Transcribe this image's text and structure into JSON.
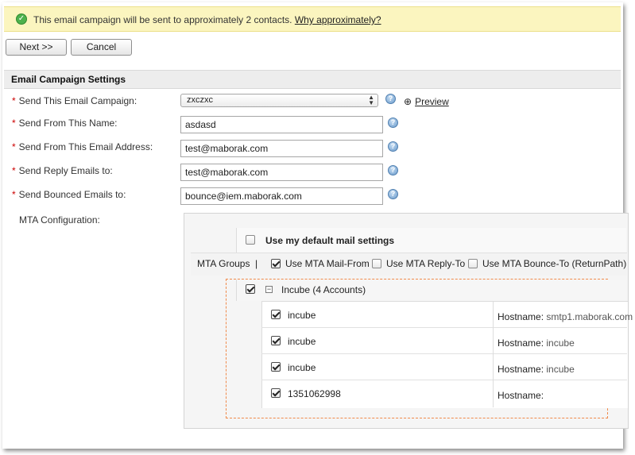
{
  "notice": {
    "message": "This email campaign will be sent to approximately 2 contacts.",
    "link": "Why approximately?"
  },
  "buttons": {
    "next": "Next >>",
    "cancel": "Cancel"
  },
  "section": {
    "title": "Email Campaign Settings"
  },
  "form": {
    "required_mark": "*",
    "campaign": {
      "label": "Send This Email Campaign:",
      "value": "zxczxc",
      "preview": "Preview"
    },
    "from_name": {
      "label": "Send From This Name:",
      "value": "asdasd"
    },
    "from_email": {
      "label": "Send From This Email Address:",
      "value": "test@maborak.com"
    },
    "reply_to": {
      "label": "Send Reply Emails to:",
      "value": "test@maborak.com"
    },
    "bounce_to": {
      "label": "Send Bounced Emails to:",
      "value": "bounce@iem.maborak.com"
    },
    "mta_label": "MTA Configuration:"
  },
  "mta": {
    "default_settings": {
      "label": "Use my default mail settings",
      "checked": false
    },
    "groups_label": "MTA Groups",
    "separator": "|",
    "mail_from": {
      "label": "Use MTA Mail-From",
      "checked": true
    },
    "reply_to": {
      "label": "Use MTA Reply-To",
      "checked": false
    },
    "bounce_to": {
      "label": "Use MTA Bounce-To (ReturnPath)",
      "checked": false
    },
    "group": {
      "label": "Incube (4 Accounts)",
      "checked": true,
      "collapse_symbol": "−"
    },
    "hostname_label": "Hostname:",
    "accounts": [
      {
        "name": "incube",
        "hostname": "smtp1.maborak.com",
        "checked": true
      },
      {
        "name": "incube",
        "hostname": "incube",
        "checked": true
      },
      {
        "name": "incube",
        "hostname": "incube",
        "checked": true
      },
      {
        "name": "1351062998",
        "hostname": "",
        "checked": true
      }
    ]
  },
  "icons": {
    "success": "check-circle-icon",
    "help": "question-circle-icon",
    "preview": "magnifier-icon",
    "select": "updown-arrows-icon",
    "collapse": "minus-box-icon"
  },
  "glyphs": {
    "success": "✓",
    "help": "?",
    "preview": "⊕",
    "select_up": "▲",
    "select_down": "▼"
  },
  "colors": {
    "notice_bg": "#fbf5bf",
    "success": "#4db14d",
    "required": "#cc0000",
    "help": "#6d9ccb",
    "dashed_border": "#f08a4b"
  }
}
